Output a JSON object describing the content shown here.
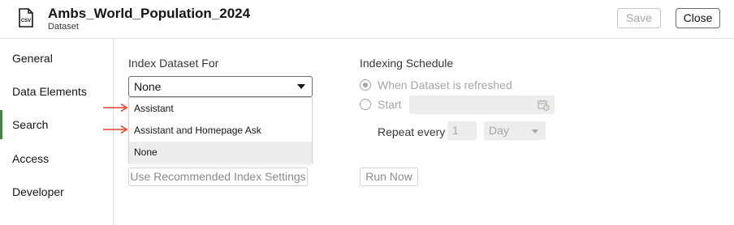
{
  "header": {
    "title": "Ambs_World_Population_2024",
    "subtitle": "Dataset",
    "file_icon_label": "CSV",
    "save_label": "Save",
    "close_label": "Close"
  },
  "sidebar": {
    "items": [
      {
        "label": "General",
        "active": false
      },
      {
        "label": "Data Elements",
        "active": false
      },
      {
        "label": "Search",
        "active": true
      },
      {
        "label": "Access",
        "active": false
      },
      {
        "label": "Developer",
        "active": false
      }
    ]
  },
  "index": {
    "label": "Index Dataset For",
    "selected": "None",
    "options": [
      "Assistant",
      "Assistant and Homepage Ask",
      "None"
    ],
    "highlighted_option": "None",
    "recommended_button": "Use Recommended Index Settings"
  },
  "schedule": {
    "label": "Indexing Schedule",
    "radio_refreshed": "When Dataset is refreshed",
    "radio_start": "Start",
    "selected_radio": "When Dataset is refreshed",
    "start_value": "",
    "repeat_label": "Repeat every",
    "repeat_value": "1",
    "repeat_unit": "Day",
    "run_now": "Run Now"
  },
  "colors": {
    "active_nav_indicator": "#4f7d4c",
    "annotation_arrow": "#e8412a",
    "disabled_text": "#a9a6a2"
  }
}
